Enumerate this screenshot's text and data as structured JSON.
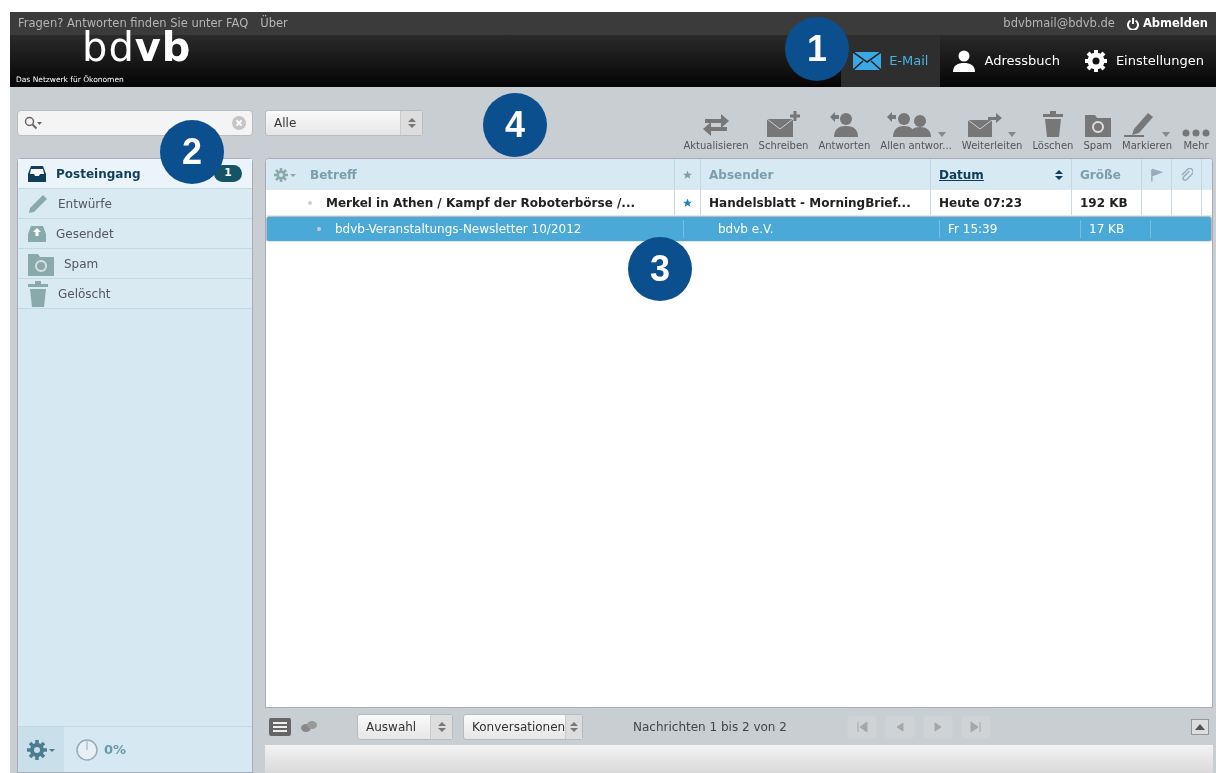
{
  "top_bar": {
    "links": [
      "Fragen? Antworten finden Sie unter FAQ",
      "Über"
    ],
    "user": "bdvbmail@bdvb.de",
    "logout": "Abmelden"
  },
  "logo": {
    "text": "bd**vb**",
    "tagline": "Das Netzwerk für Ökonomen"
  },
  "nav": [
    {
      "label": "E-Mail",
      "kind": "mail",
      "selected": true
    },
    {
      "label": "Adressbuch",
      "kind": "person",
      "selected": false
    },
    {
      "label": "Einstellungen",
      "kind": "gear",
      "selected": false
    }
  ],
  "filter": {
    "value": "Alle"
  },
  "toolbar": [
    {
      "label": "Aktualisieren",
      "kind": "refresh",
      "dropdown": false
    },
    {
      "label": "Schreiben",
      "kind": "compose",
      "dropdown": false
    },
    {
      "label": "Antworten",
      "kind": "reply",
      "dropdown": false
    },
    {
      "label": "Allen antwor...",
      "kind": "replyall",
      "dropdown": true
    },
    {
      "label": "Weiterleiten",
      "kind": "forward",
      "dropdown": true
    },
    {
      "label": "Löschen",
      "kind": "trash",
      "dropdown": false
    },
    {
      "label": "Spam",
      "kind": "spam",
      "dropdown": false
    },
    {
      "label": "Markieren",
      "kind": "mark",
      "dropdown": true
    },
    {
      "label": "Mehr",
      "kind": "more",
      "dropdown": false
    }
  ],
  "folders": [
    {
      "label": "Posteingang",
      "kind": "inbox",
      "selected": true,
      "count": "1"
    },
    {
      "label": "Entwürfe",
      "kind": "pencil",
      "selected": false
    },
    {
      "label": "Gesendet",
      "kind": "sent",
      "selected": false
    },
    {
      "label": "Spam",
      "kind": "spam",
      "selected": false
    },
    {
      "label": "Gelöscht",
      "kind": "trash",
      "selected": false
    }
  ],
  "quota": {
    "reading": "0%"
  },
  "table": {
    "columns": [
      {
        "kind": "text",
        "label": "Betreff",
        "sorted": false
      },
      {
        "kind": "star"
      },
      {
        "kind": "text",
        "label": "Absender",
        "sorted": false
      },
      {
        "kind": "text",
        "label": "Datum",
        "sorted": true
      },
      {
        "kind": "text",
        "label": "Größe",
        "sorted": false
      },
      {
        "kind": "flag"
      },
      {
        "kind": "attachment"
      }
    ],
    "rows": [
      {
        "subject": "Merkel in Athen / Kampf der Roboterbörse /...",
        "starred": true,
        "sender": "Handelsblatt - MorningBrief...",
        "date": "Heute 07:23",
        "size": "192 KB",
        "unread": true,
        "selected": false
      },
      {
        "subject": "bdvb-Veranstaltungs-Newsletter 10/2012",
        "starred": false,
        "sender": "bdvb e.V.",
        "date": "Fr 15:39",
        "size": "17 KB",
        "unread": false,
        "selected": true
      }
    ]
  },
  "footer": {
    "selects": [
      "Auswahl",
      "Konversationen"
    ],
    "count_text": "Nachrichten 1 bis 2 von 2",
    "pager_disabled": true
  },
  "callouts": [
    "1",
    "2",
    "3",
    "4"
  ]
}
